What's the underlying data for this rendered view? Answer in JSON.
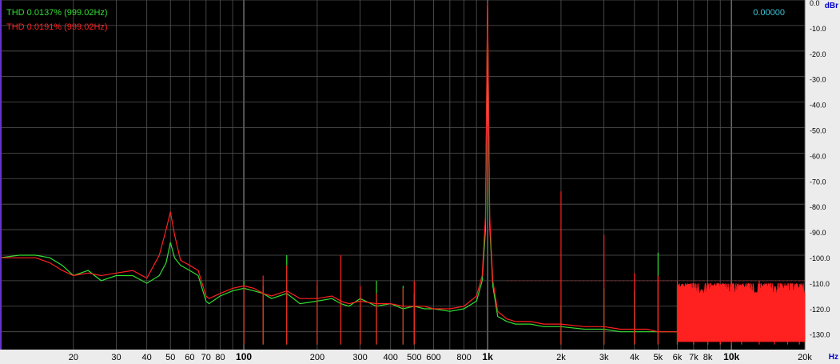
{
  "chart_data": {
    "type": "line",
    "title": "",
    "xlabel": "Hz",
    "ylabel": "dBr",
    "xscale": "log",
    "xlim": [
      10,
      20000
    ],
    "ylim": [
      -137,
      0
    ],
    "grid": true,
    "legend_placement": "top-left",
    "x_ticks": [
      {
        "v": 20,
        "label": "20"
      },
      {
        "v": 30,
        "label": "30"
      },
      {
        "v": 40,
        "label": "40"
      },
      {
        "v": 50,
        "label": "50"
      },
      {
        "v": 60,
        "label": "60"
      },
      {
        "v": 70,
        "label": "70"
      },
      {
        "v": 80,
        "label": "80"
      },
      {
        "v": 100,
        "label": "100",
        "bold": true
      },
      {
        "v": 200,
        "label": "200"
      },
      {
        "v": 300,
        "label": "300"
      },
      {
        "v": 400,
        "label": "400"
      },
      {
        "v": 500,
        "label": "500"
      },
      {
        "v": 600,
        "label": "600"
      },
      {
        "v": 800,
        "label": "800"
      },
      {
        "v": 1000,
        "label": "1k",
        "bold": true
      },
      {
        "v": 2000,
        "label": "2k"
      },
      {
        "v": 3000,
        "label": "3k"
      },
      {
        "v": 4000,
        "label": "4k"
      },
      {
        "v": 5000,
        "label": "5k"
      },
      {
        "v": 6000,
        "label": "6k"
      },
      {
        "v": 7000,
        "label": "7k"
      },
      {
        "v": 8000,
        "label": "8k"
      },
      {
        "v": 10000,
        "label": "10k",
        "bold": true
      },
      {
        "v": 20000,
        "label": "20k"
      }
    ],
    "y_ticks": [
      {
        "v": 0,
        "label": "0.0"
      },
      {
        "v": -10,
        "label": "-10.0"
      },
      {
        "v": -20,
        "label": "-20.0"
      },
      {
        "v": -30,
        "label": "-30.0"
      },
      {
        "v": -40,
        "label": "-40.0"
      },
      {
        "v": -50,
        "label": "-50.0"
      },
      {
        "v": -60,
        "label": "-60.0"
      },
      {
        "v": -70,
        "label": "-70.0"
      },
      {
        "v": -80,
        "label": "-80.0"
      },
      {
        "v": -90,
        "label": "-90.0"
      },
      {
        "v": -100,
        "label": "-100.0"
      },
      {
        "v": -110,
        "label": "-110.0"
      },
      {
        "v": -120,
        "label": "-120.0"
      },
      {
        "v": -130,
        "label": "-130.0"
      }
    ],
    "series": [
      {
        "name": "THD 0.0137% (999.02Hz)",
        "color": "#33dd33",
        "x": [
          10,
          12,
          14,
          16,
          18,
          20,
          23,
          26,
          30,
          35,
          40,
          45,
          48,
          50,
          52,
          55,
          60,
          65,
          70,
          72,
          80,
          90,
          100,
          110,
          120,
          130,
          150,
          170,
          200,
          230,
          250,
          270,
          300,
          350,
          400,
          450,
          500,
          550,
          600,
          700,
          800,
          900,
          950,
          980,
          999,
          1020,
          1050,
          1100,
          1200,
          1300,
          1500,
          1700,
          2000,
          2500,
          3000,
          3500,
          4000,
          4500,
          5000,
          6000,
          7000,
          8000,
          10000,
          12000,
          15000,
          20000
        ],
        "y": [
          -101,
          -100,
          -100,
          -101,
          -104,
          -108,
          -106,
          -110,
          -108,
          -108,
          -111,
          -108,
          -103,
          -95,
          -101,
          -104,
          -106,
          -108,
          -118,
          -119,
          -116,
          -114,
          -113,
          -114,
          -115,
          -117,
          -115,
          -119,
          -118,
          -117,
          -119,
          -120,
          -117,
          -120,
          -119,
          -121,
          -120,
          -121,
          -121,
          -122,
          -121,
          -118,
          -110,
          -90,
          -2,
          -88,
          -112,
          -124,
          -126,
          -127,
          -127,
          -128,
          -128,
          -129,
          -129,
          -130,
          -130,
          -130,
          -130,
          -130,
          -130,
          -130,
          -130,
          -130,
          -130,
          -130
        ],
        "spikes": [
          {
            "x": 100,
            "y": -110
          },
          {
            "x": 120,
            "y": -112
          },
          {
            "x": 150,
            "y": -100
          },
          {
            "x": 200,
            "y": -112
          },
          {
            "x": 250,
            "y": -110
          },
          {
            "x": 300,
            "y": -113
          },
          {
            "x": 350,
            "y": -110
          },
          {
            "x": 450,
            "y": -112
          },
          {
            "x": 500,
            "y": -115
          },
          {
            "x": 2000,
            "y": -120
          },
          {
            "x": 3000,
            "y": -113
          },
          {
            "x": 4000,
            "y": -114
          },
          {
            "x": 5000,
            "y": -99
          },
          {
            "x": 6000,
            "y": -112
          },
          {
            "x": 7000,
            "y": -114
          },
          {
            "x": 8000,
            "y": -116
          },
          {
            "x": 9000,
            "y": -118
          }
        ]
      },
      {
        "name": "THD 0.0191% (999.02Hz)",
        "color": "#ff2020",
        "x": [
          10,
          12,
          14,
          16,
          18,
          20,
          23,
          26,
          30,
          35,
          40,
          45,
          48,
          50,
          52,
          55,
          60,
          65,
          70,
          72,
          80,
          90,
          100,
          110,
          120,
          130,
          150,
          170,
          200,
          230,
          250,
          270,
          300,
          350,
          400,
          450,
          500,
          550,
          600,
          700,
          800,
          900,
          950,
          980,
          999,
          1020,
          1050,
          1100,
          1200,
          1300,
          1500,
          1700,
          2000,
          2500,
          3000,
          3500,
          4000,
          4500,
          5000,
          6000,
          7000,
          8000,
          10000,
          12000,
          15000,
          20000
        ],
        "y": [
          -101,
          -101,
          -101,
          -103,
          -106,
          -108,
          -107,
          -108,
          -107,
          -106,
          -109,
          -100,
          -90,
          -83,
          -92,
          -102,
          -104,
          -106,
          -116,
          -117,
          -115,
          -113,
          -112,
          -113,
          -115,
          -116,
          -114,
          -117,
          -117,
          -116,
          -118,
          -119,
          -118,
          -119,
          -119,
          -120,
          -120,
          -120,
          -121,
          -121,
          -120,
          -116,
          -108,
          -85,
          -1,
          -85,
          -110,
          -122,
          -125,
          -126,
          -126,
          -127,
          -127,
          -128,
          -128,
          -129,
          -129,
          -129,
          -130,
          -130,
          -130,
          -130,
          -130,
          -130,
          -130,
          -130
        ],
        "spikes": [
          {
            "x": 100,
            "y": -112
          },
          {
            "x": 120,
            "y": -108
          },
          {
            "x": 150,
            "y": -104
          },
          {
            "x": 200,
            "y": -110
          },
          {
            "x": 250,
            "y": -100
          },
          {
            "x": 300,
            "y": -112
          },
          {
            "x": 350,
            "y": -115
          },
          {
            "x": 450,
            "y": -113
          },
          {
            "x": 500,
            "y": -110
          },
          {
            "x": 2000,
            "y": -75
          },
          {
            "x": 3000,
            "y": -92
          },
          {
            "x": 4000,
            "y": -107
          },
          {
            "x": 5000,
            "y": -108
          },
          {
            "x": 6000,
            "y": -110
          },
          {
            "x": 7000,
            "y": -112
          },
          {
            "x": 8000,
            "y": -111
          },
          {
            "x": 9000,
            "y": -112
          },
          {
            "x": 10000,
            "y": -115
          },
          {
            "x": 11000,
            "y": -112
          },
          {
            "x": 13000,
            "y": -110
          },
          {
            "x": 15000,
            "y": -113
          },
          {
            "x": 17000,
            "y": -112
          },
          {
            "x": 19000,
            "y": -114
          }
        ]
      }
    ],
    "readout": "0.00000"
  }
}
